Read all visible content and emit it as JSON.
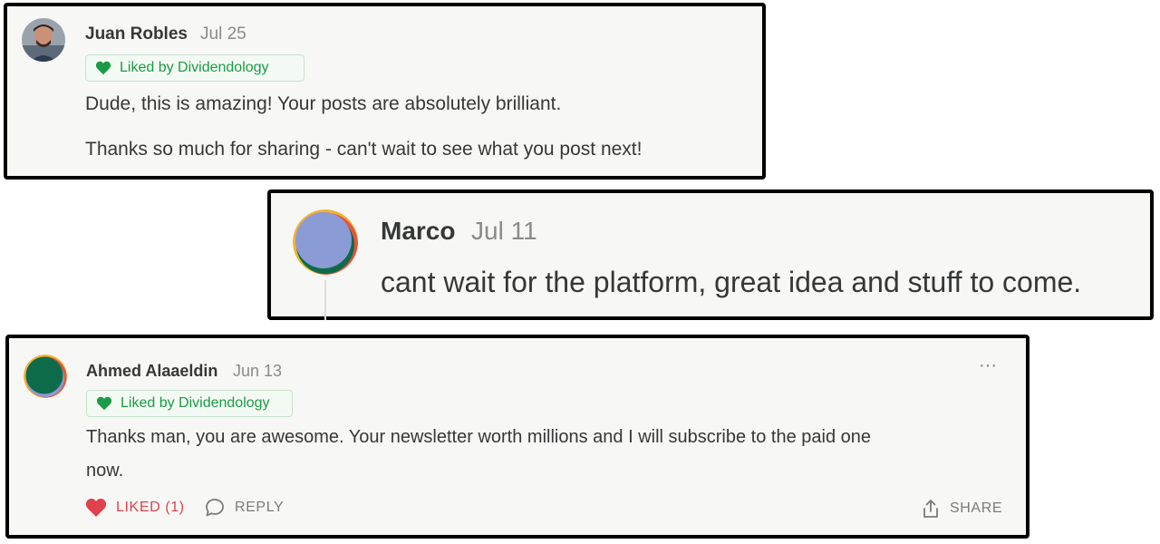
{
  "comments": [
    {
      "author": "Juan Robles",
      "date": "Jul 25",
      "badge": "Liked by Dividendology",
      "paragraphs": [
        "Dude, this is amazing! Your posts are absolutely brilliant.",
        "Thanks so much for sharing - can't wait to see what you post next!"
      ]
    },
    {
      "author": "Marco",
      "date": "Jul 11",
      "paragraphs": [
        "cant wait for the platform, great idea and stuff to come."
      ]
    },
    {
      "author": "Ahmed Alaaeldin",
      "date": "Jun 13",
      "badge": "Liked by Dividendology",
      "paragraphs": [
        "Thanks man, you are awesome. Your newsletter worth millions and I will subscribe to the paid one",
        "now."
      ],
      "more": "···",
      "actions": {
        "liked": "LIKED (1)",
        "reply": "REPLY",
        "share": "SHARE"
      }
    }
  ],
  "colors": {
    "liked_green": "#1c9a46",
    "liked_red": "#e0414b",
    "card_bg": "#f7f8f6"
  },
  "icons": [
    "heart-icon",
    "comment-bubble-icon",
    "share-icon",
    "more-icon"
  ]
}
